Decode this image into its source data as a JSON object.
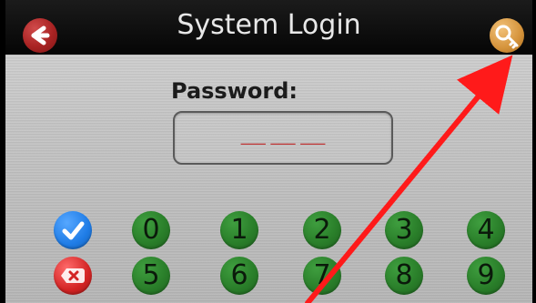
{
  "app": {
    "title": "System Login"
  },
  "login": {
    "password_label": "Password:",
    "password_placeholder": "___ ___ ___"
  },
  "keypad": {
    "keys_row1": [
      "0",
      "1",
      "2",
      "3",
      "4"
    ],
    "keys_row2": [
      "5",
      "6",
      "7",
      "8",
      "9"
    ],
    "confirm_icon": "check-icon",
    "delete_icon": "backspace-icon"
  },
  "toolbar": {
    "back_icon": "back-arrow-icon",
    "key_icon": "key-icon"
  },
  "annotation": {
    "arrow_color": "#ff1a1a"
  }
}
